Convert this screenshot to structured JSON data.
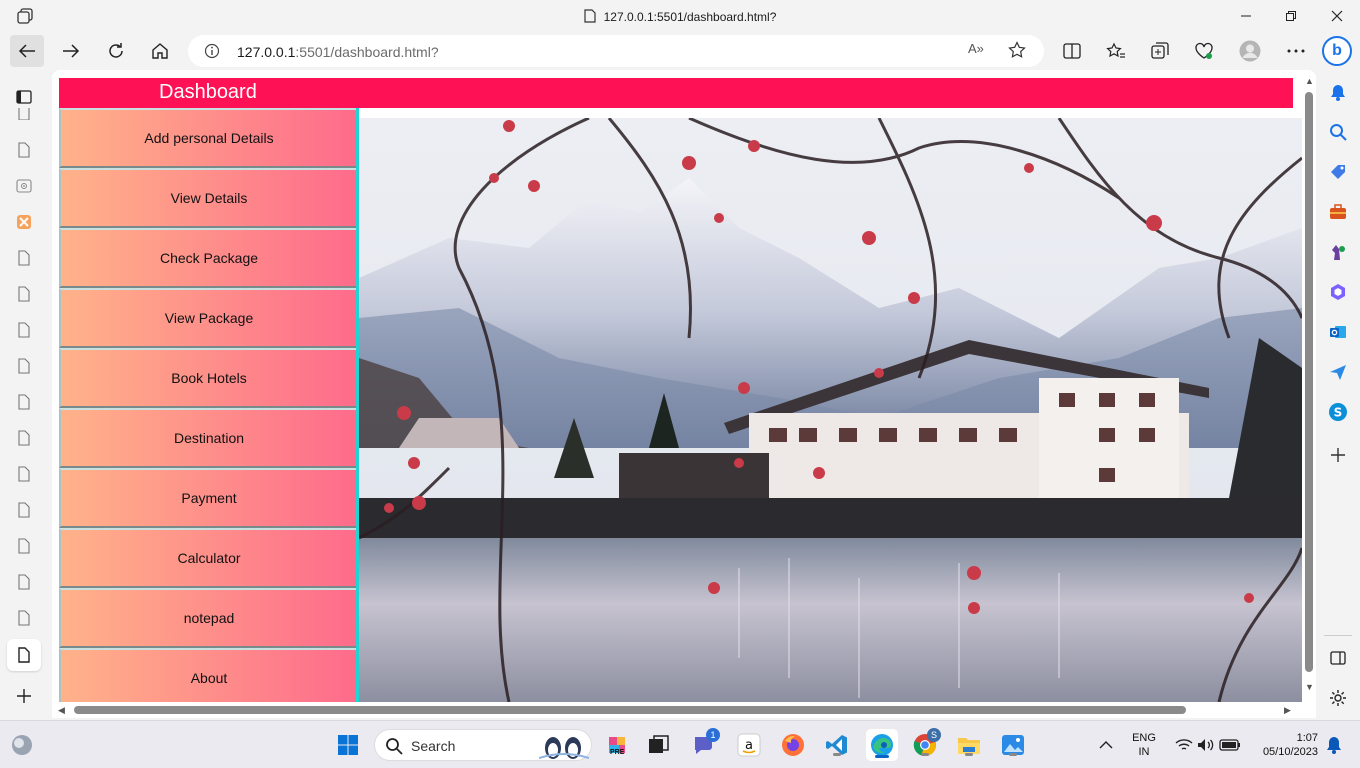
{
  "window": {
    "title": "127.0.0.1:5501/dashboard.html?"
  },
  "toolbar": {
    "url_host": "127.0.0.1",
    "url_rest": ":5501/dashboard.html?",
    "read_aloud": "A»"
  },
  "page": {
    "header_title": "Dashboard",
    "menu": [
      {
        "label": "Add personal Details"
      },
      {
        "label": "View Details"
      },
      {
        "label": "Check Package"
      },
      {
        "label": "View Package"
      },
      {
        "label": "Book Hotels"
      },
      {
        "label": "Destination"
      },
      {
        "label": "Payment"
      },
      {
        "label": "Calculator"
      },
      {
        "label": "notepad"
      },
      {
        "label": "About"
      }
    ],
    "colors": {
      "header": "#ff1155",
      "menu_gradient_start": "#ffb38a",
      "menu_gradient_end": "#fe6b8b",
      "divider": "#20d4d4"
    }
  },
  "taskbar": {
    "search_label": "Search",
    "teams_badge": "1",
    "chrome_badge": "S",
    "language_line1": "ENG",
    "language_line2": "IN",
    "time": "1:07",
    "date": "05/10/2023",
    "pre_label": "PRE"
  }
}
